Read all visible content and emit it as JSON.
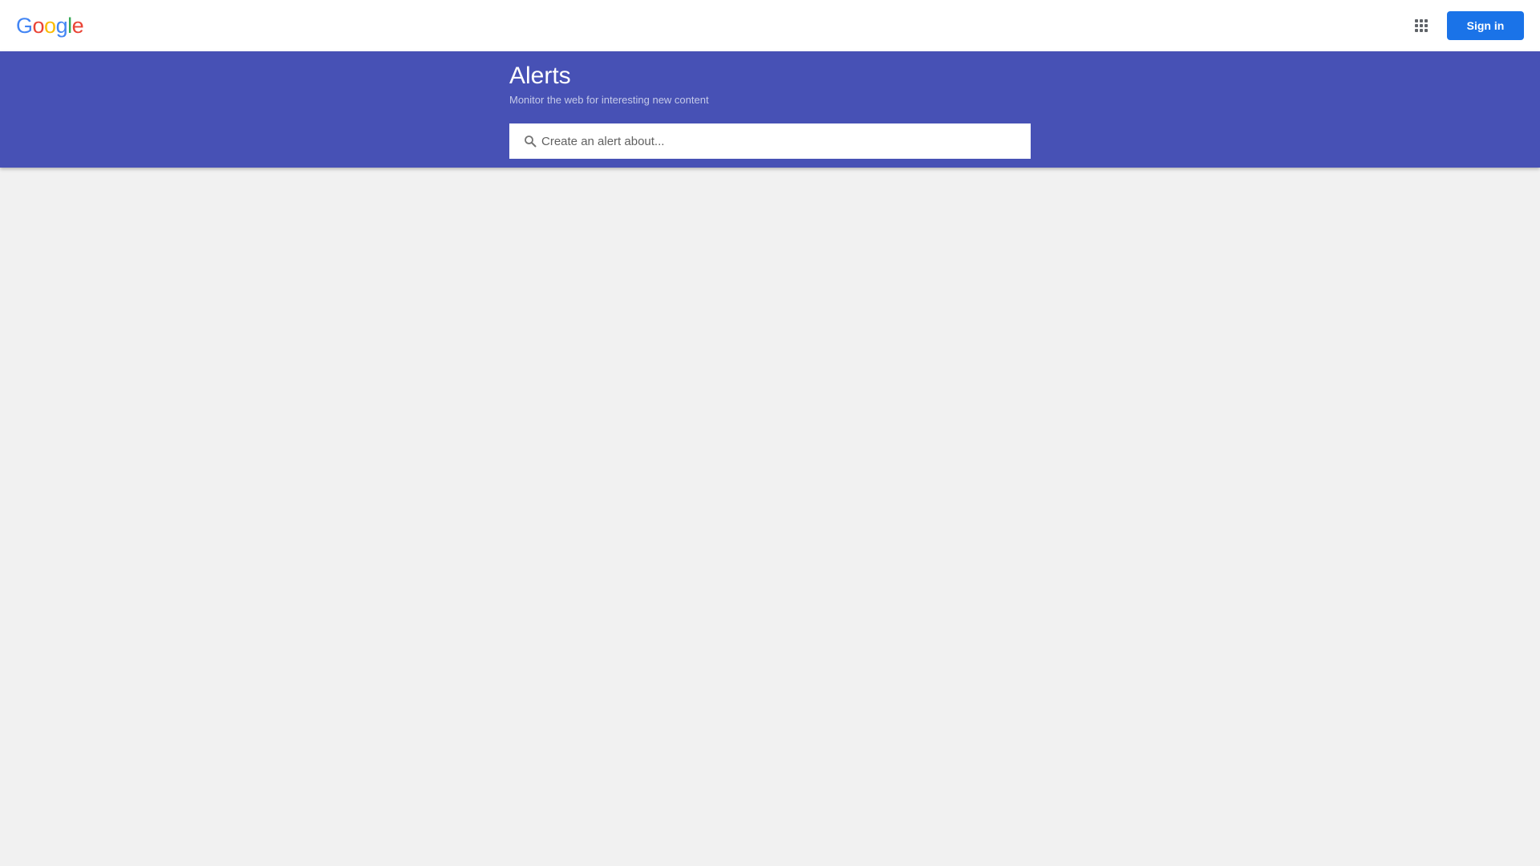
{
  "header": {
    "logo_letters": [
      {
        "char": "G",
        "color": "#4285F4"
      },
      {
        "char": "o",
        "color": "#EA4335"
      },
      {
        "char": "o",
        "color": "#FBBC05"
      },
      {
        "char": "g",
        "color": "#4285F4"
      },
      {
        "char": "l",
        "color": "#34A853"
      },
      {
        "char": "e",
        "color": "#EA4335"
      }
    ],
    "apps_icon": "apps-grid-icon",
    "signin_label": "Sign in",
    "signin_color": "#1a73e8"
  },
  "banner": {
    "background": "#4751b5",
    "title": "Alerts",
    "subtitle": "Monitor the web for interesting new content"
  },
  "search": {
    "icon": "search-icon",
    "placeholder": "Create an alert about...",
    "value": ""
  },
  "page": {
    "background": "#f1f1f1"
  }
}
